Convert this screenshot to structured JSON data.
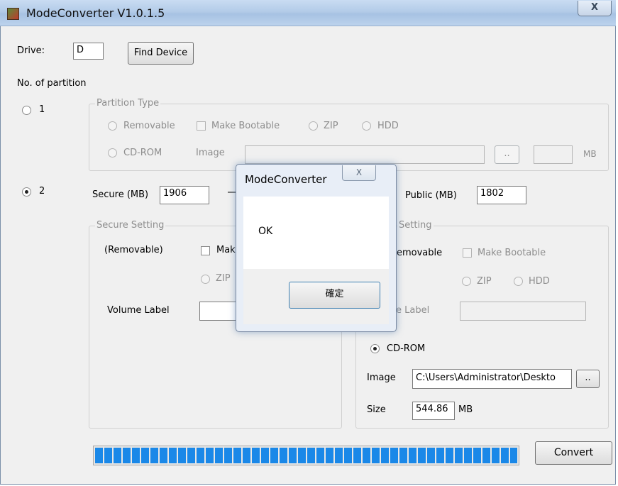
{
  "window": {
    "title": "ModeConverter V1.0.1.5",
    "close_symbol": "X"
  },
  "drive": {
    "label": "Drive:",
    "value": "D",
    "find_button": "Find Device"
  },
  "partition_count_label": "No. of partition",
  "option1": {
    "label": "1",
    "selected": false,
    "group_title": "Partition Type",
    "removable": "Removable",
    "make_bootable": "Make Bootable",
    "zip": "ZIP",
    "hdd": "HDD",
    "cdrom": "CD-ROM",
    "image_label": "Image",
    "image_value": "",
    "browse": "..",
    "size_value": "",
    "mb": "MB"
  },
  "option2": {
    "label": "2",
    "selected": true,
    "secure_label": "Secure (MB)",
    "secure_value": "1906",
    "public_label": "Public (MB)",
    "public_value": "1802"
  },
  "secure_setting": {
    "title": "Secure Setting",
    "removable": "(Removable)",
    "make_bootable": "Mak",
    "zip": "ZIP",
    "volume_label": "Volume Label",
    "volume_value": ""
  },
  "public_setting": {
    "title": "Setting",
    "removable": "emovable",
    "make_bootable": "Make Bootable",
    "zip": "ZIP",
    "hdd": "HDD",
    "volume_label": "e Label",
    "volume_value": "",
    "cdrom": "CD-ROM",
    "cdrom_selected": true,
    "image_label": "Image",
    "image_value": "C:\\Users\\Administrator\\Deskto",
    "browse": "..",
    "size_label": "Size",
    "size_value": "544.86",
    "size_unit": "MB"
  },
  "progress": {
    "percent": 100,
    "color": "#1a88e8"
  },
  "convert_button": "Convert",
  "dialog": {
    "title": "ModeConverter",
    "close_symbol": "X",
    "message": "OK",
    "ok_button": "確定"
  }
}
